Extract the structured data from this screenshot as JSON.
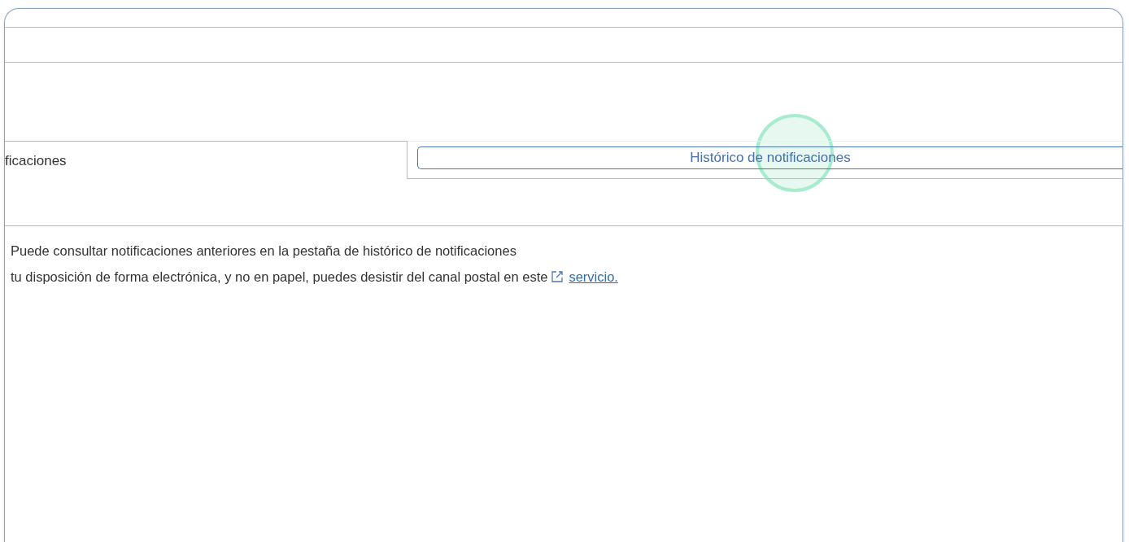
{
  "tabs": [
    {
      "label": "ficaciones",
      "selected": true
    },
    {
      "label": "Histórico de notificaciones",
      "selected": false
    }
  ],
  "click_indicator": {
    "on": true
  },
  "info": {
    "line_1": "Puede consultar notificaciones anteriores en la pestaña de histórico de notificaciones",
    "line_2": "tu disposición de forma electrónica, y no en papel, puedes desistir del canal postal en este",
    "link": "servicio."
  }
}
